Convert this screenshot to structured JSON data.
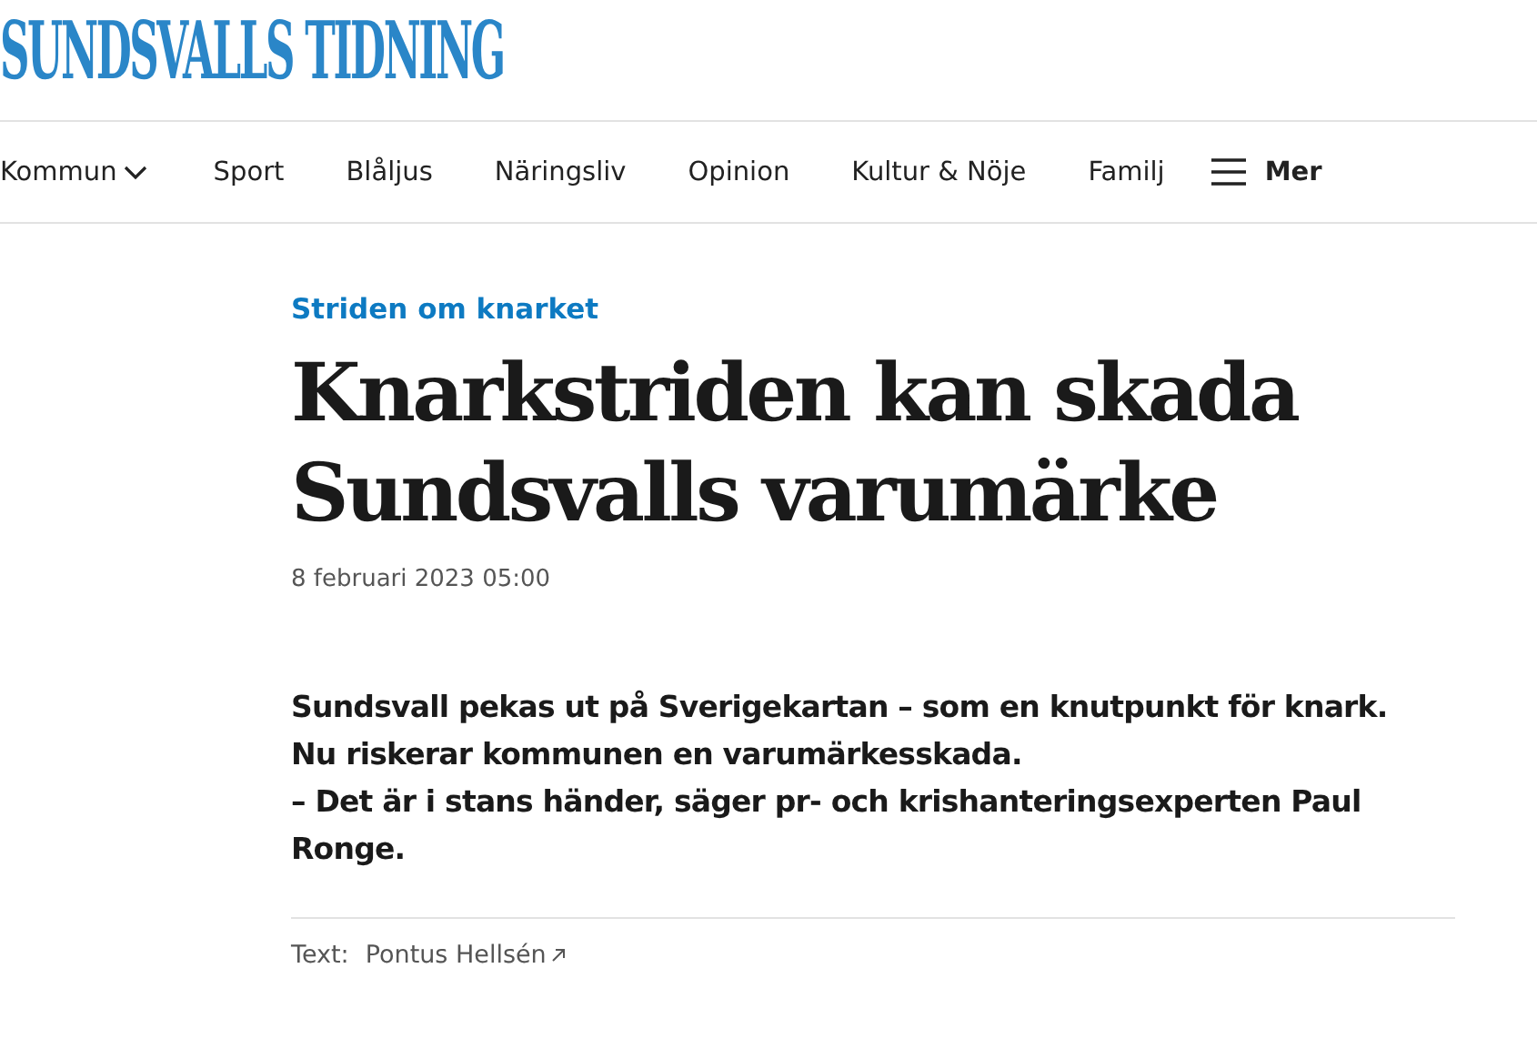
{
  "logo": "SUNDSVALLS TIDNING",
  "nav": [
    {
      "label": "Kommun",
      "kind": "dropdown"
    },
    {
      "label": "Sport",
      "kind": "link"
    },
    {
      "label": "Blåljus",
      "kind": "link"
    },
    {
      "label": "Näringsliv",
      "kind": "link"
    },
    {
      "label": "Opinion",
      "kind": "link"
    },
    {
      "label": "Kultur & Nöje",
      "kind": "link"
    },
    {
      "label": "Familj",
      "kind": "link"
    },
    {
      "label": "Mer",
      "kind": "menu"
    }
  ],
  "article": {
    "topic": "Striden om knarket",
    "headline": "Knarkstriden kan skada Sundsvalls varumärke",
    "date": "8 februari 2023 05:00",
    "lead": [
      "Sundsvall pekas ut på Sverigekartan – som en knutpunkt för knark.",
      "Nu riskerar kommunen en varumärkesskada.",
      "– Det är i stans händer, säger pr- och krishanteringsexperten Paul Ronge."
    ],
    "byline": {
      "label": "Text:",
      "author": "Pontus Hellsén"
    }
  }
}
